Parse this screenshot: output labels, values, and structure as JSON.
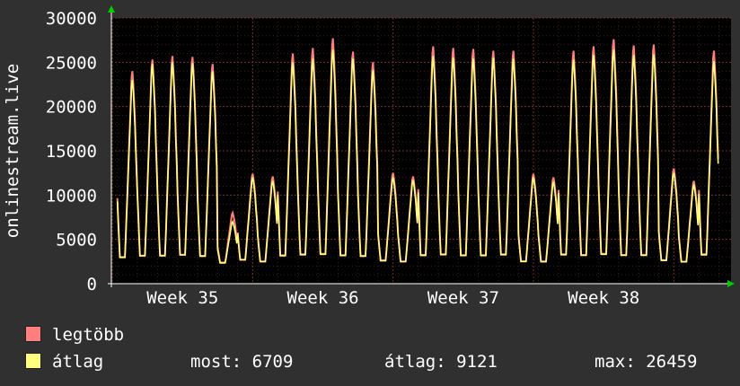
{
  "chart_data": {
    "type": "area",
    "ylabel": "onlinestream.live",
    "ylim": [
      0,
      30000
    ],
    "yticks": [
      "0",
      "5000",
      "10000",
      "15000",
      "20000",
      "25000",
      "30000"
    ],
    "xticks": [
      "Week 35",
      "Week 36",
      "Week 37",
      "Week 38"
    ],
    "grid": true,
    "days": 30,
    "daily_peak_max": [
      24000,
      25300,
      25700,
      25600,
      24800,
      8000,
      12400,
      12100,
      26000,
      26600,
      27700,
      26200,
      25000,
      12500,
      12100,
      26800,
      26600,
      26500,
      26300,
      26300,
      12400,
      12000,
      26300,
      26800,
      27600,
      26900,
      27000,
      13000,
      11600,
      26300
    ],
    "daily_peak_avg": [
      23000,
      24800,
      25000,
      24900,
      24000,
      7000,
      12000,
      11600,
      25000,
      25400,
      26400,
      25400,
      24100,
      12000,
      11700,
      25700,
      25500,
      25400,
      25500,
      25400,
      12000,
      11500,
      25300,
      25800,
      26400,
      25800,
      25900,
      12500,
      11200,
      25100
    ],
    "daily_trough": [
      1900,
      2000,
      2000,
      2100,
      2000,
      2100,
      2200,
      2000,
      2000,
      2100,
      2100,
      2000,
      2000,
      2100,
      2000,
      2000,
      2100,
      2000,
      2000,
      2100,
      2000,
      2000,
      2100,
      2000,
      2100,
      2000,
      2000,
      2100,
      2000,
      2100
    ],
    "series": [
      {
        "name": "legtöbb",
        "color": "#ff7f7f"
      },
      {
        "name": "átlag",
        "color": "#ffff7f"
      }
    ]
  },
  "legend": {
    "max_label": "legtöbb",
    "avg_label": "átlag"
  },
  "stats": {
    "current": "most: 6709",
    "average": "átlag: 9121",
    "maximum": "max: 26459"
  },
  "colors": {
    "background": "#303030",
    "plot_background": "#000000",
    "grid": "#5a2a2a",
    "axis": "#ffffff",
    "arrow": "#00cc00"
  }
}
